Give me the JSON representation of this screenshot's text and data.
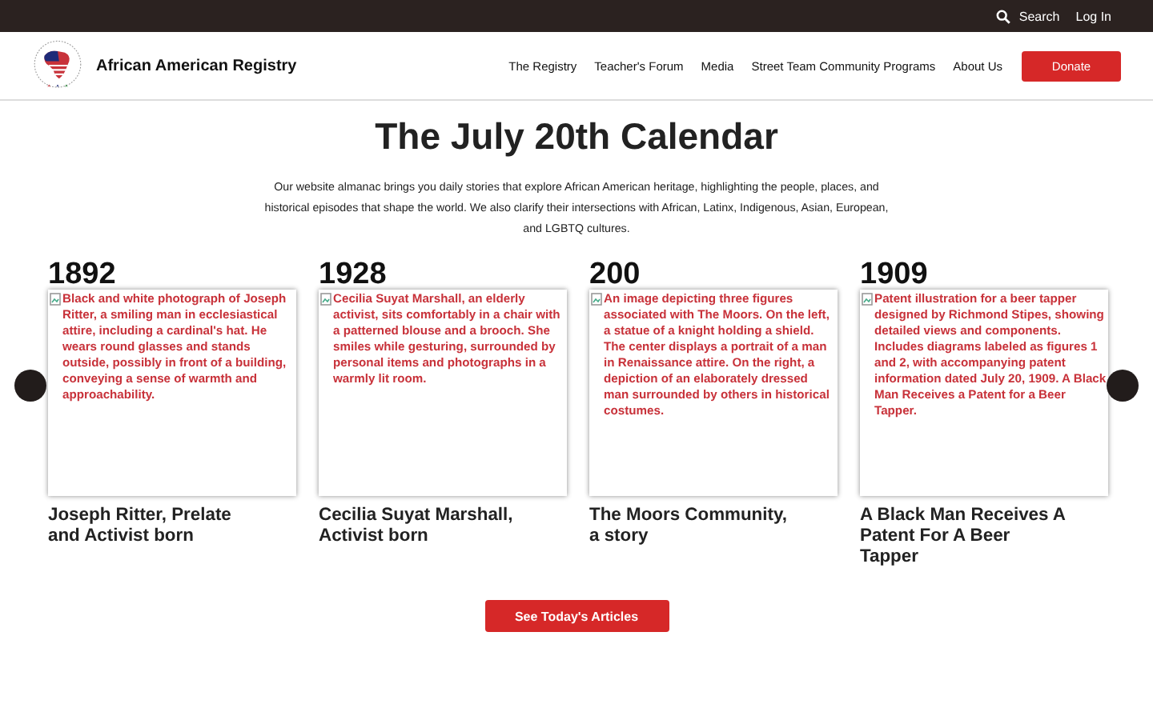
{
  "top_bar": {
    "search": "Search",
    "login": "Log In"
  },
  "header": {
    "site_name": "African American Registry",
    "nav": [
      "The Registry",
      "Teacher's Forum",
      "Media",
      "Street Team Community Programs",
      "About Us"
    ],
    "donate": "Donate"
  },
  "title": "The July 20th Calendar",
  "intro": "Our website almanac brings you daily stories that explore African American heritage, highlighting the people, places, and historical episodes that shape the world. We also clarify their intersections with African, Latinx, Indigenous, Asian, European, and LGBTQ cultures.",
  "cards": [
    {
      "year": "1892",
      "image_alt": "Black and white photograph of Joseph Ritter, a smiling man in ecclesiastical attire, including a cardinal's hat. He wears round glasses and stands outside, possibly in front of a building, conveying a sense of warmth and approachability.",
      "caption": "Joseph Ritter, Prelate and Activist born"
    },
    {
      "year": "1928",
      "image_alt": "Cecilia Suyat Marshall, an elderly activist, sits comfortably in a chair with a patterned blouse and a brooch. She smiles while gesturing, surrounded by personal items and photographs in a warmly lit room.",
      "caption": "Cecilia Suyat Marshall, Activist born"
    },
    {
      "year": "200",
      "image_alt": "An image depicting three figures associated with The Moors. On the left, a statue of a knight holding a shield. The center displays a portrait of a man in Renaissance attire. On the right, a depiction of an elaborately dressed man surrounded by others in historical costumes.",
      "caption": "The Moors Community, a story"
    },
    {
      "year": "1909",
      "image_alt": "Patent illustration for a beer tapper designed by Richmond Stipes, showing detailed views and components. Includes diagrams labeled as figures 1 and 2, with accompanying patent information dated July 20, 1909. A Black Man Receives a Patent for a Beer Tapper.",
      "caption": "A Black Man Receives A Patent For A Beer Tapper"
    }
  ],
  "cta": "See Today's Articles"
}
